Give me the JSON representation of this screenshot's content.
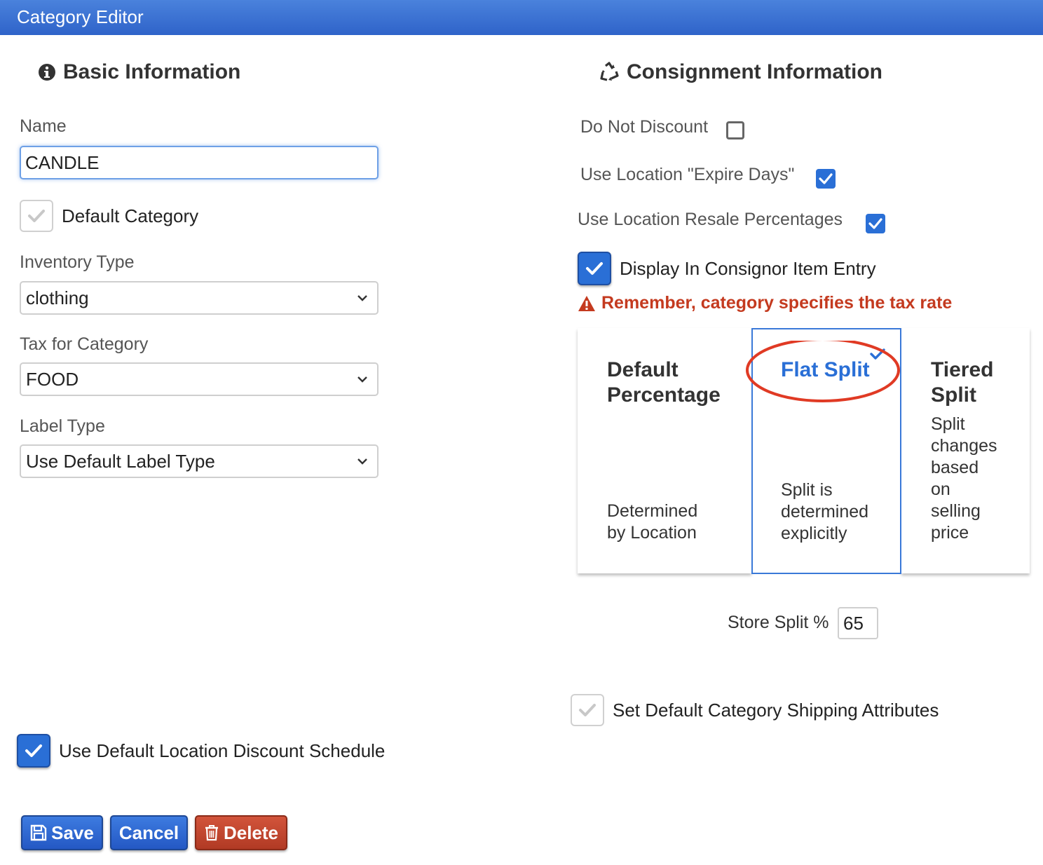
{
  "window": {
    "title": "Category Editor"
  },
  "basic": {
    "title": "Basic Information",
    "name_label": "Name",
    "name_value": "CANDLE",
    "default_category_label": "Default Category",
    "inventory_type_label": "Inventory Type",
    "inventory_type_value": "clothing",
    "tax_label": "Tax for Category",
    "tax_value": "FOOD",
    "label_type_label": "Label Type",
    "label_type_value": "Use Default Label Type",
    "discount_schedule_label": "Use Default Location Discount Schedule"
  },
  "consignment": {
    "title": "Consignment Information",
    "do_not_discount_label": "Do Not Discount",
    "use_expire_days_label": "Use Location \"Expire Days\"",
    "use_resale_label": "Use Location Resale Percentages",
    "display_consignor_label": "Display In Consignor Item Entry",
    "warning": "Remember, category specifies the tax rate",
    "options": [
      {
        "title_line1": "Default",
        "title_line2": "Percentage",
        "desc_line1": "Determined",
        "desc_line2": "by Location",
        "selected": false
      },
      {
        "title": "Flat Split",
        "desc_line1": "Split is",
        "desc_line2": "determined",
        "desc_line3": "explicitly",
        "selected": true
      },
      {
        "title_line1": "Tiered",
        "title_line2": "Split",
        "desc_line1": "Split",
        "desc_line2": "changes",
        "desc_line3": "based",
        "desc_line4": "on",
        "desc_line5": "selling",
        "desc_line6": "price",
        "selected": false
      }
    ],
    "store_split_label": "Store Split %",
    "store_split_value": "65",
    "shipping_label": "Set Default Category Shipping Attributes"
  },
  "buttons": {
    "save": "Save",
    "cancel": "Cancel",
    "delete": "Delete"
  },
  "colors": {
    "accent": "#2a6fd6",
    "titlebar": "#3a72d4",
    "danger": "#c43a1f",
    "highlight_circle": "#e03a24"
  },
  "icons": {
    "info": "info-circle-icon",
    "recycle": "recycle-icon",
    "warning": "warning-icon",
    "save": "floppy-disk-icon",
    "delete": "trash-icon",
    "check": "check-icon",
    "chevron": "chevron-down-icon"
  }
}
